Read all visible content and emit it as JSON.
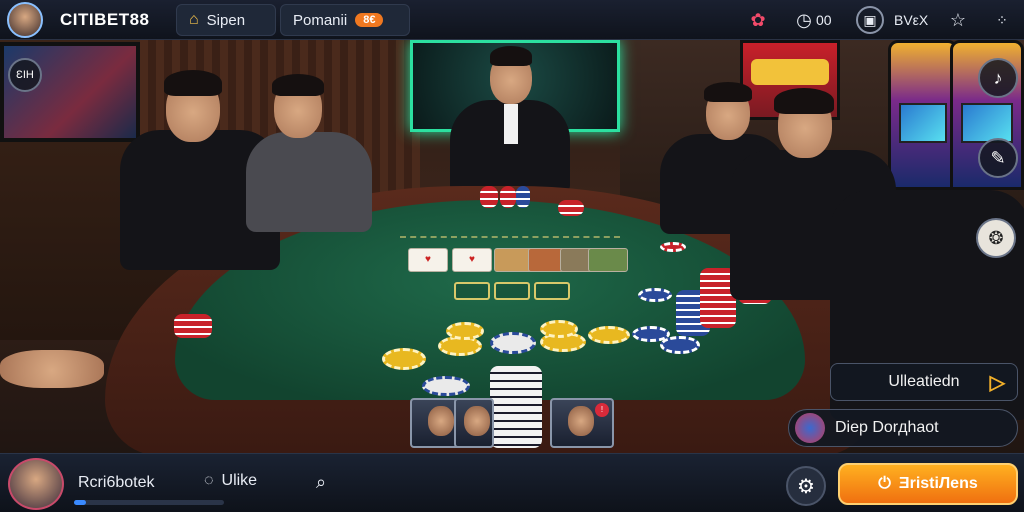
{
  "header": {
    "brand": "CITIBET88",
    "tabs": [
      {
        "label": "Sipen"
      },
      {
        "label": "Pomanii",
        "badge": "8€"
      }
    ],
    "status_text": "00",
    "menu_text": "ΒVεX"
  },
  "left_panel": {
    "tag_label": "ƐIH"
  },
  "right_panel": {
    "primary_button": "Ulleatiedn",
    "secondary_button": "Diep Dorдhaot"
  },
  "bottom_bar": {
    "player_name": "Rcri6botek",
    "xp_progress": 0.08,
    "like_label": "Ulike",
    "cta_label": "ƎristiЛens"
  },
  "icons": {
    "logo_avatar": "avatar",
    "tab1": "home-icon",
    "gift": "gift-icon",
    "timer": "clock-icon",
    "fullscreen": "frame-icon",
    "star": "star-icon",
    "more": "grid-icon",
    "settings": "gear-icon",
    "search": "search-icon",
    "like": "chat-icon"
  },
  "colors": {
    "accent": "#f2b02a",
    "cta": "#f07a10",
    "felt": "#1f6a4a"
  }
}
